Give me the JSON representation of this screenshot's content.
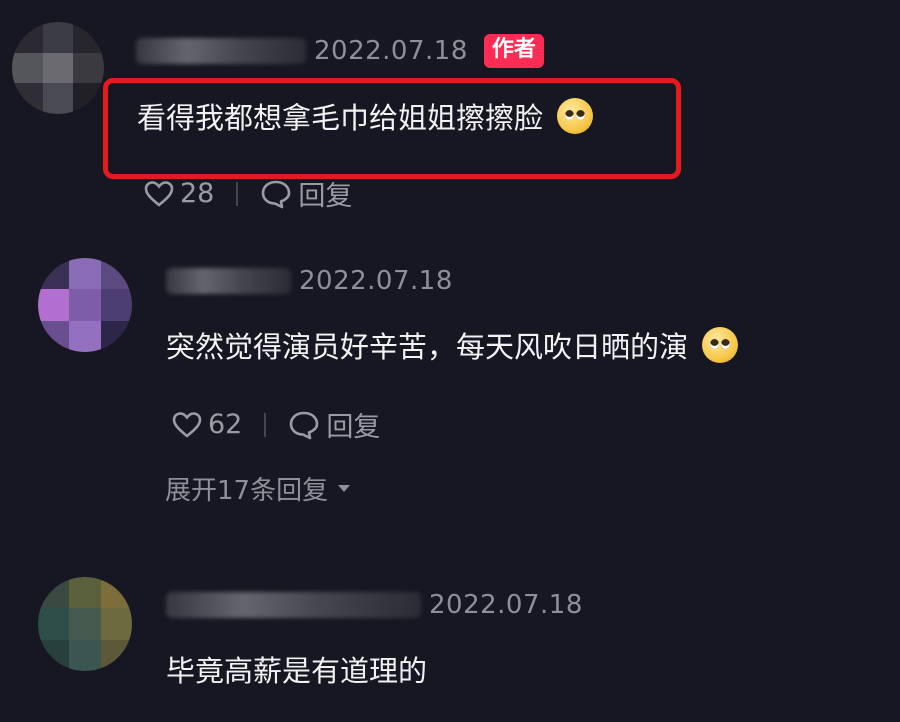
{
  "comments": [
    {
      "date": "2022.07.18",
      "badge": "作者",
      "text": "看得我都想拿毛巾给姐姐擦擦脸",
      "emoji": "pleading-face",
      "likes": "28",
      "reply_label": "回复"
    },
    {
      "date": "2022.07.18",
      "text": "突然觉得演员好辛苦，每天风吹日晒的演",
      "emoji": "pleading-face",
      "likes": "62",
      "reply_label": "回复",
      "expand_label": "展开17条回复"
    },
    {
      "date": "2022.07.18",
      "text": "毕竟高薪是有道理的"
    }
  ],
  "colors": {
    "background": "#161722",
    "author_badge": "#fe2c55",
    "highlight_box": "#e5191e"
  }
}
